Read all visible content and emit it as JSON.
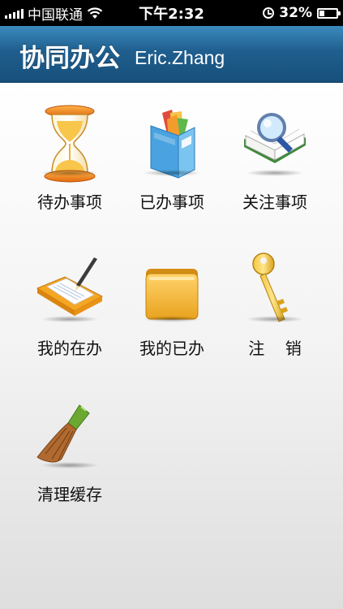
{
  "status_bar": {
    "carrier": "中国联通",
    "time": "下午2:32",
    "battery": "32%",
    "battery_level": 0.32,
    "signal_icon": "signal-bars-icon",
    "wifi_icon": "wifi-icon",
    "orientation_lock_icon": "orientation-lock-icon",
    "battery_icon": "battery-icon"
  },
  "header": {
    "title": "协同办公",
    "user": "Eric.Zhang"
  },
  "tiles": [
    {
      "label": "待办事项",
      "icon": "hourglass-icon"
    },
    {
      "label": "已办事项",
      "icon": "folder-documents-icon"
    },
    {
      "label": "关注事项",
      "icon": "magnifier-book-icon"
    },
    {
      "label": "我的在办",
      "icon": "notebook-pen-icon"
    },
    {
      "label": "我的已办",
      "icon": "closed-folder-icon"
    },
    {
      "label": "注    销",
      "icon": "key-icon"
    },
    {
      "label": "清理缓存",
      "icon": "broom-icon"
    }
  ]
}
